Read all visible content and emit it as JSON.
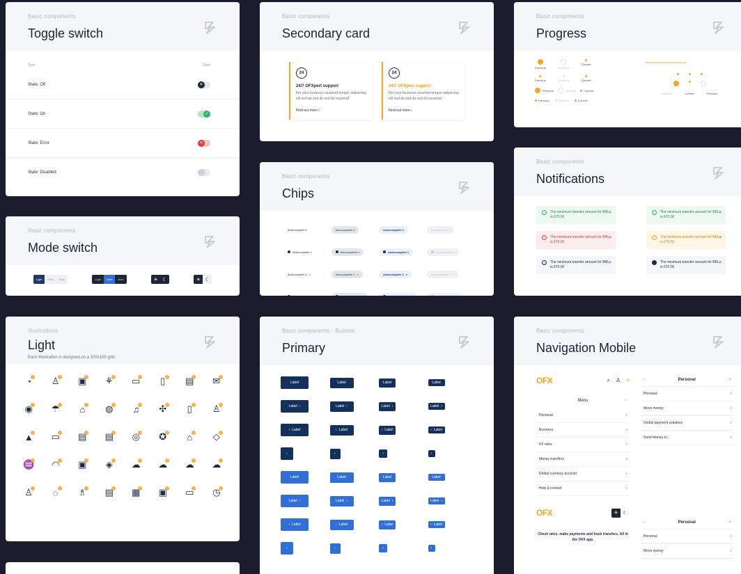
{
  "cards": {
    "toggle": {
      "sub": "Basic components",
      "title": "Toggle switch",
      "col_type": "Type",
      "col_state": "State",
      "rows": [
        {
          "label": "State: Off",
          "glyph": "✕"
        },
        {
          "label": "State: On",
          "glyph": "✓"
        },
        {
          "label": "State: Error",
          "glyph": "✕"
        },
        {
          "label": "State: Disabled",
          "glyph": ""
        }
      ]
    },
    "mode": {
      "sub": "Basic components",
      "title": "Mode switch",
      "seg": [
        "Light",
        "Dark",
        "Auto"
      ],
      "sun_icon": "☀",
      "moon_icon": "☾"
    },
    "illustrations": {
      "sub": "Illustrations",
      "title": "Light",
      "desc": "Each Illustration is designed on a 100x100 grid.",
      "icons": [
        "24h-support-icon",
        "user-search-icon",
        "wallet-icon",
        "plant-growth-icon",
        "money-card-icon",
        "mobile-transfer-icon",
        "browser-window-icon",
        "envelope-icon",
        "eye-icon",
        "umbrella-icon",
        "bank-icon",
        "globe-icon",
        "alarm-bell-icon",
        "network-nodes-icon",
        "mobile-payment-icon",
        "cashier-icon",
        "rocket-icon",
        "laptop-icon",
        "chat-bubble-icon",
        "message-icon",
        "coin-icon",
        "award-badge-icon",
        "home-icon",
        "diamond-icon",
        "money-hand-icon",
        "headset-icon",
        "padlock-icon",
        "location-pin-icon",
        "cloud-icon",
        "cloud-upload-icon",
        "cloud-download-icon",
        "cloud-sync-icon",
        "person-desk-icon",
        "idea-bulb-icon",
        "team-icon",
        "documents-icon",
        "calculator-icon",
        "calendar-lock-icon",
        "wallet-card-icon",
        "timer-dollar-icon"
      ],
      "glyphs": [
        "◔",
        "♙",
        "▣",
        "⚘",
        "▭",
        "▯",
        "▤",
        "✉",
        "◉",
        "☂",
        "⌂",
        "◍",
        "♫",
        "✣",
        "▯",
        "♙",
        "▲",
        "▭",
        "▤",
        "▤",
        "◎",
        "✪",
        "⌂",
        "◇",
        "♒",
        "◠",
        "▣",
        "◈",
        "☁",
        "☁",
        "☁",
        "☁",
        "♙",
        "◌",
        "♗",
        "▤",
        "▦",
        "▣",
        "▭",
        "◷"
      ]
    },
    "secondary": {
      "sub": "Basic components",
      "title": "Secondary card",
      "items": [
        {
          "icon": "24",
          "title": "24/7 OFXpert support",
          "body": "For your business eiusmod tempor adipiscing elit sed do sed do sed do eiusmod",
          "link": "Find out more  ›"
        },
        {
          "icon": "24",
          "title": "24/7 OFXpert support",
          "body": "For your business eiusmod tempor adipiscing elit sed do sed do sed do eiusmod",
          "link": "Find out more  ›"
        }
      ]
    },
    "chips": {
      "sub": "Basic components",
      "title": "Chips",
      "label": "Autocomplete 1",
      "x": "×"
    },
    "primary": {
      "sub": "Basic components - Buttons",
      "title": "Primary",
      "label": "Label",
      "arrow_r": "›",
      "arrow_l": "‹"
    },
    "progress": {
      "sub": "Basic components",
      "title": "Progress",
      "steps": [
        "Previous",
        "Disabled",
        "Current"
      ]
    },
    "notifications": {
      "sub": "Basic components",
      "title": "Notifications",
      "message": "The minimum transfer amount for BRL is 670.00",
      "close": "×"
    },
    "navmobile": {
      "sub": "Basic components",
      "title": "Navigation Mobile",
      "brand": "OFX",
      "menu_title": "Menu",
      "menu_items": [
        "Personal",
        "Business",
        "FX rates",
        "Money transfers",
        "Global currency account",
        "Help & contact"
      ],
      "personal_title": "Personal",
      "personal_items": [
        "Personal",
        "Move money",
        "Global payment solutions",
        "Send money to..."
      ],
      "personal_items_2": [
        "Personal",
        "Move money"
      ],
      "tagline": "Check rates, make payments and track transfers. All in the OFX app."
    }
  },
  "colors": {
    "bg": "#1b1d2e",
    "accent": "#f5a623",
    "primary_dark": "#13315c",
    "primary": "#2f6fd6"
  }
}
